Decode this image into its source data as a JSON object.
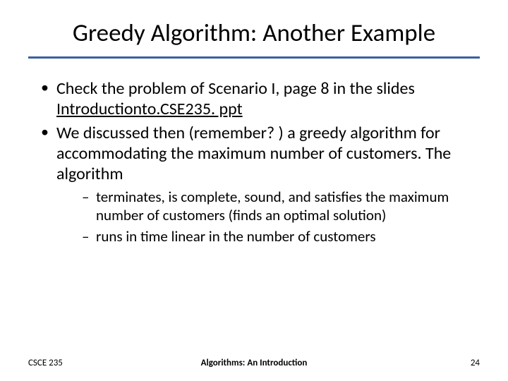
{
  "title": "Greedy Algorithm: Another Example",
  "bullets": [
    {
      "pre": "Check the problem of Scenario I, page 8 in the slides ",
      "link": "Introductionto.CSE235. ppt",
      "post": ""
    },
    {
      "pre": "We discussed then (remember? ) a greedy algorithm for accommodating the maximum number of customers. The algorithm",
      "link": "",
      "post": ""
    }
  ],
  "subbullets": [
    "terminates, is complete, sound, and satisfies the maximum number of customers (finds an optimal solution)",
    "runs in time linear in the number of customers"
  ],
  "footer": {
    "left": "CSCE 235",
    "center": "Algorithms: An Introduction",
    "right": "24"
  }
}
